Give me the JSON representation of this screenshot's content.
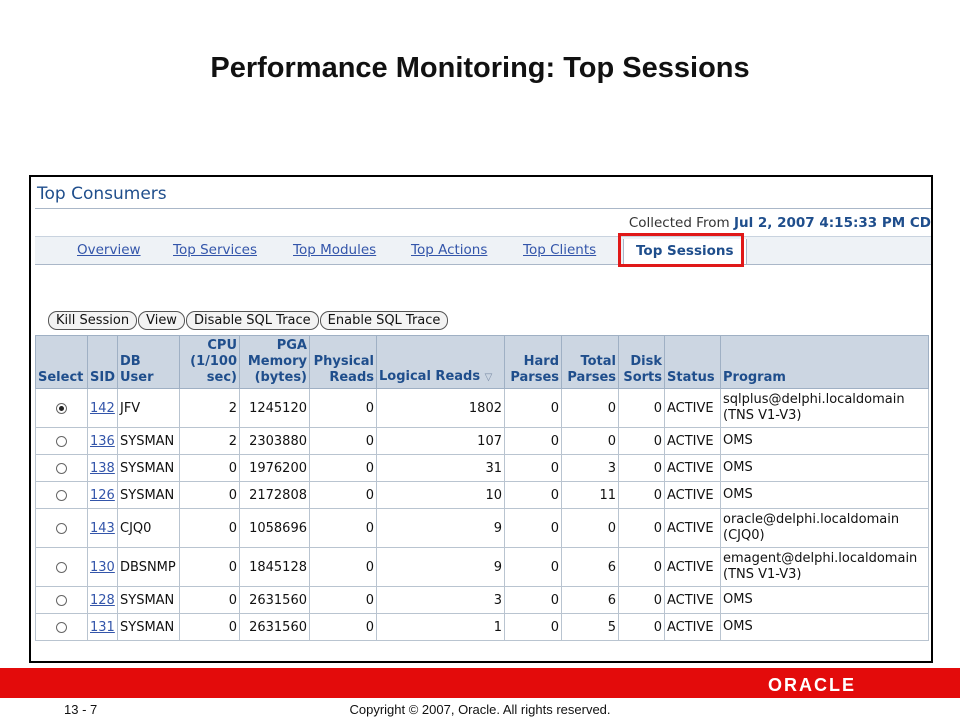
{
  "slide": {
    "title": "Performance Monitoring: Top Sessions",
    "page_number": "13 - 7",
    "copyright": "Copyright © 2007, Oracle. All rights reserved.",
    "logo": "ORACLE"
  },
  "panel": {
    "title": "Top Consumers",
    "collected_label": "Collected From",
    "collected_value": "Jul 2, 2007 4:15:33 PM CD"
  },
  "tabs": [
    "Overview",
    "Top Services",
    "Top Modules",
    "Top Actions",
    "Top Clients",
    "Top Sessions"
  ],
  "buttons": {
    "kill": "Kill Session",
    "view": "View",
    "disable_trace": "Disable SQL Trace",
    "enable_trace": "Enable SQL Trace"
  },
  "columns": {
    "select": "Select",
    "sid": "SID",
    "db_user": "DB User",
    "cpu": "CPU (1/100 sec)",
    "pga": "PGA Memory (bytes)",
    "physical_reads": "Physical Reads",
    "logical_reads": "Logical Reads",
    "hard_parses": "Hard Parses",
    "total_parses": "Total Parses",
    "disk_sorts": "Disk Sorts",
    "status": "Status",
    "program": "Program"
  },
  "rows": [
    {
      "sid": "142",
      "user": "JFV",
      "cpu": "2",
      "pga": "1245120",
      "phys": "0",
      "logical": "1802",
      "hard": "0",
      "total": "0",
      "disk": "0",
      "status": "ACTIVE",
      "program": "sqlplus@delphi.localdomain (TNS V1-V3)"
    },
    {
      "sid": "136",
      "user": "SYSMAN",
      "cpu": "2",
      "pga": "2303880",
      "phys": "0",
      "logical": "107",
      "hard": "0",
      "total": "0",
      "disk": "0",
      "status": "ACTIVE",
      "program": "OMS"
    },
    {
      "sid": "138",
      "user": "SYSMAN",
      "cpu": "0",
      "pga": "1976200",
      "phys": "0",
      "logical": "31",
      "hard": "0",
      "total": "3",
      "disk": "0",
      "status": "ACTIVE",
      "program": "OMS"
    },
    {
      "sid": "126",
      "user": "SYSMAN",
      "cpu": "0",
      "pga": "2172808",
      "phys": "0",
      "logical": "10",
      "hard": "0",
      "total": "11",
      "disk": "0",
      "status": "ACTIVE",
      "program": "OMS"
    },
    {
      "sid": "143",
      "user": "CJQ0",
      "cpu": "0",
      "pga": "1058696",
      "phys": "0",
      "logical": "9",
      "hard": "0",
      "total": "0",
      "disk": "0",
      "status": "ACTIVE",
      "program": "oracle@delphi.localdomain (CJQ0)"
    },
    {
      "sid": "130",
      "user": "DBSNMP",
      "cpu": "0",
      "pga": "1845128",
      "phys": "0",
      "logical": "9",
      "hard": "0",
      "total": "6",
      "disk": "0",
      "status": "ACTIVE",
      "program": "emagent@delphi.localdomain (TNS V1-V3)"
    },
    {
      "sid": "128",
      "user": "SYSMAN",
      "cpu": "0",
      "pga": "2631560",
      "phys": "0",
      "logical": "3",
      "hard": "0",
      "total": "6",
      "disk": "0",
      "status": "ACTIVE",
      "program": "OMS"
    },
    {
      "sid": "131",
      "user": "SYSMAN",
      "cpu": "0",
      "pga": "2631560",
      "phys": "0",
      "logical": "1",
      "hard": "0",
      "total": "5",
      "disk": "0",
      "status": "ACTIVE",
      "program": "OMS"
    }
  ],
  "colors": {
    "accent": "#1f4e8c",
    "link": "#3355aa",
    "header_bg": "#ccd6e2",
    "highlight": "#e01818",
    "footer": "#e30b0b"
  },
  "icons": {
    "sort": "sort-descending-icon",
    "radio": "radio-button"
  }
}
